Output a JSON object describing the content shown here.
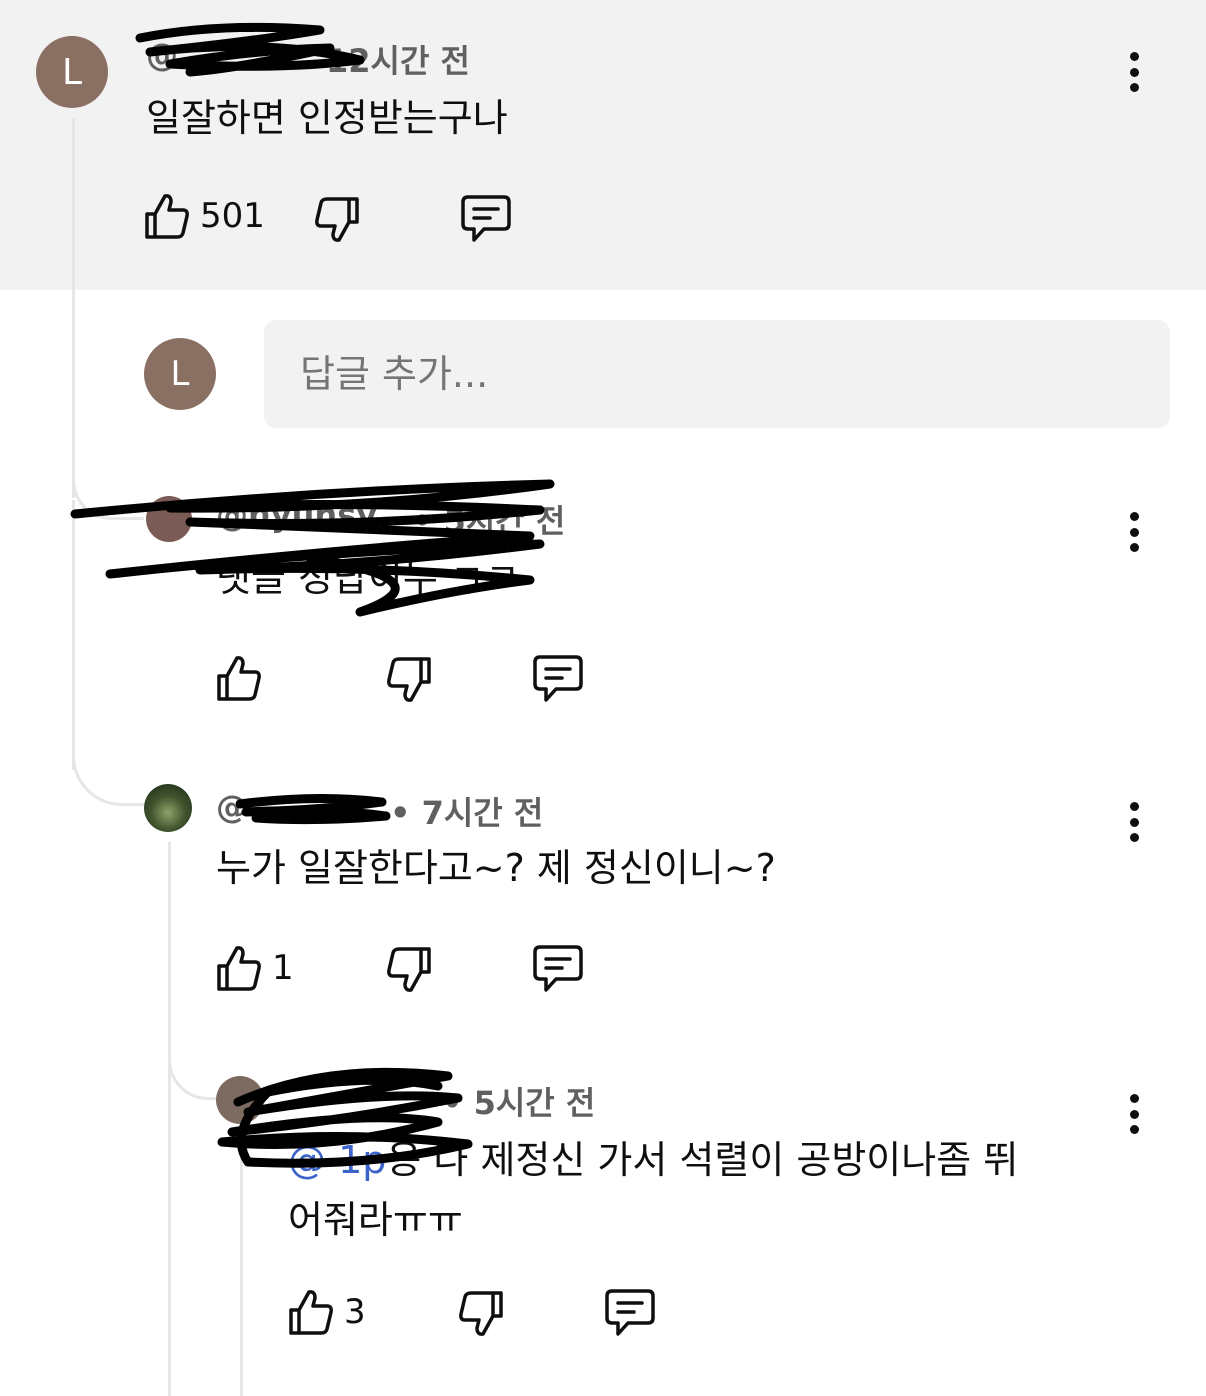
{
  "comment_main": {
    "avatar_letter": "L",
    "handle": "@",
    "time": "12시간 전",
    "text": "일잘하면 인정받는구나",
    "likes": "501"
  },
  "reply_box": {
    "avatar_letter": "L",
    "placeholder": "답글 추가..."
  },
  "reply_1": {
    "handle": "@hyunsy",
    "time": "• 5시간 전",
    "text": "댓글 정답이누 ㄱㅋ"
  },
  "reply_2": {
    "handle": "@",
    "time": "• 7시간 전",
    "text": "누가 일잘한다고~?  제 정신이니~?",
    "likes": "1"
  },
  "reply_3": {
    "time": "• 5시간 전",
    "mention": "@      1p",
    "text_line1": "응 나 제정신 가서 석렬이 공방이나좀 뛰",
    "text_line2": "어줘라ㅠㅠ",
    "likes": "3"
  },
  "icons": {
    "like": "thumb-up-icon",
    "dislike": "thumb-down-icon",
    "reply": "comment-icon",
    "more": "more-vertical-icon"
  }
}
